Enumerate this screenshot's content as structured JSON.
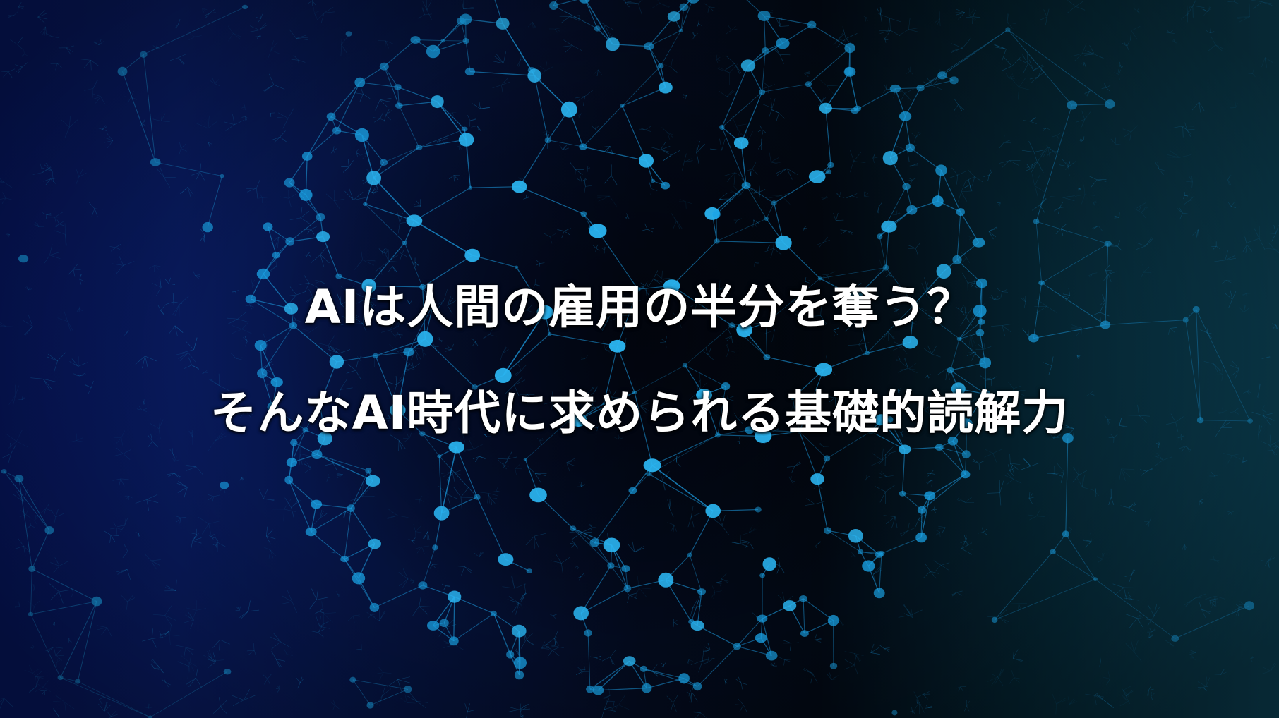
{
  "headline": {
    "line1": "AIは人間の雇用の半分を奪う？",
    "line2": "そんなAI時代に求められる基礎的読解力"
  },
  "colors": {
    "node": "#1aa3e6",
    "node_bright": "#2bb6f2",
    "link": "#1a8fd0",
    "background_left": "#06155a",
    "background_center": "#030a1c",
    "background_right": "#0b3f52",
    "text": "#ffffff"
  }
}
